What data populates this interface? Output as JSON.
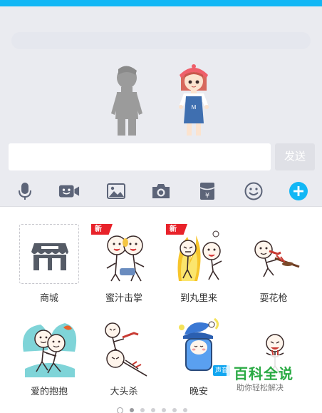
{
  "chat_input": {
    "placeholder": "",
    "send_label": "发送"
  },
  "toolbar": {
    "icons": [
      {
        "name": "microphone-icon"
      },
      {
        "name": "video-call-icon"
      },
      {
        "name": "image-icon"
      },
      {
        "name": "camera-icon"
      },
      {
        "name": "red-packet-icon"
      },
      {
        "name": "emoji-icon"
      },
      {
        "name": "add-more-icon",
        "accent": "#12b7f5"
      }
    ]
  },
  "stickers": [
    {
      "label": "商城",
      "badge": ""
    },
    {
      "label": "蜜汁击掌",
      "badge": "新"
    },
    {
      "label": "到丸里来",
      "badge": "新"
    },
    {
      "label": "耍花枪",
      "badge": ""
    },
    {
      "label": "爱的抱抱",
      "badge": ""
    },
    {
      "label": "大头杀",
      "badge": ""
    },
    {
      "label": "晚安",
      "badge": "",
      "tag": "声音"
    },
    {
      "label": "",
      "badge": ""
    }
  ],
  "pagination": {
    "pages": 6,
    "active": 1
  },
  "watermark": {
    "title": "百科全说",
    "subtitle": "助你轻松解决"
  },
  "colors": {
    "accent": "#12b7f5",
    "badge_red": "#e8222a",
    "watermark_green": "#2aaa44"
  }
}
